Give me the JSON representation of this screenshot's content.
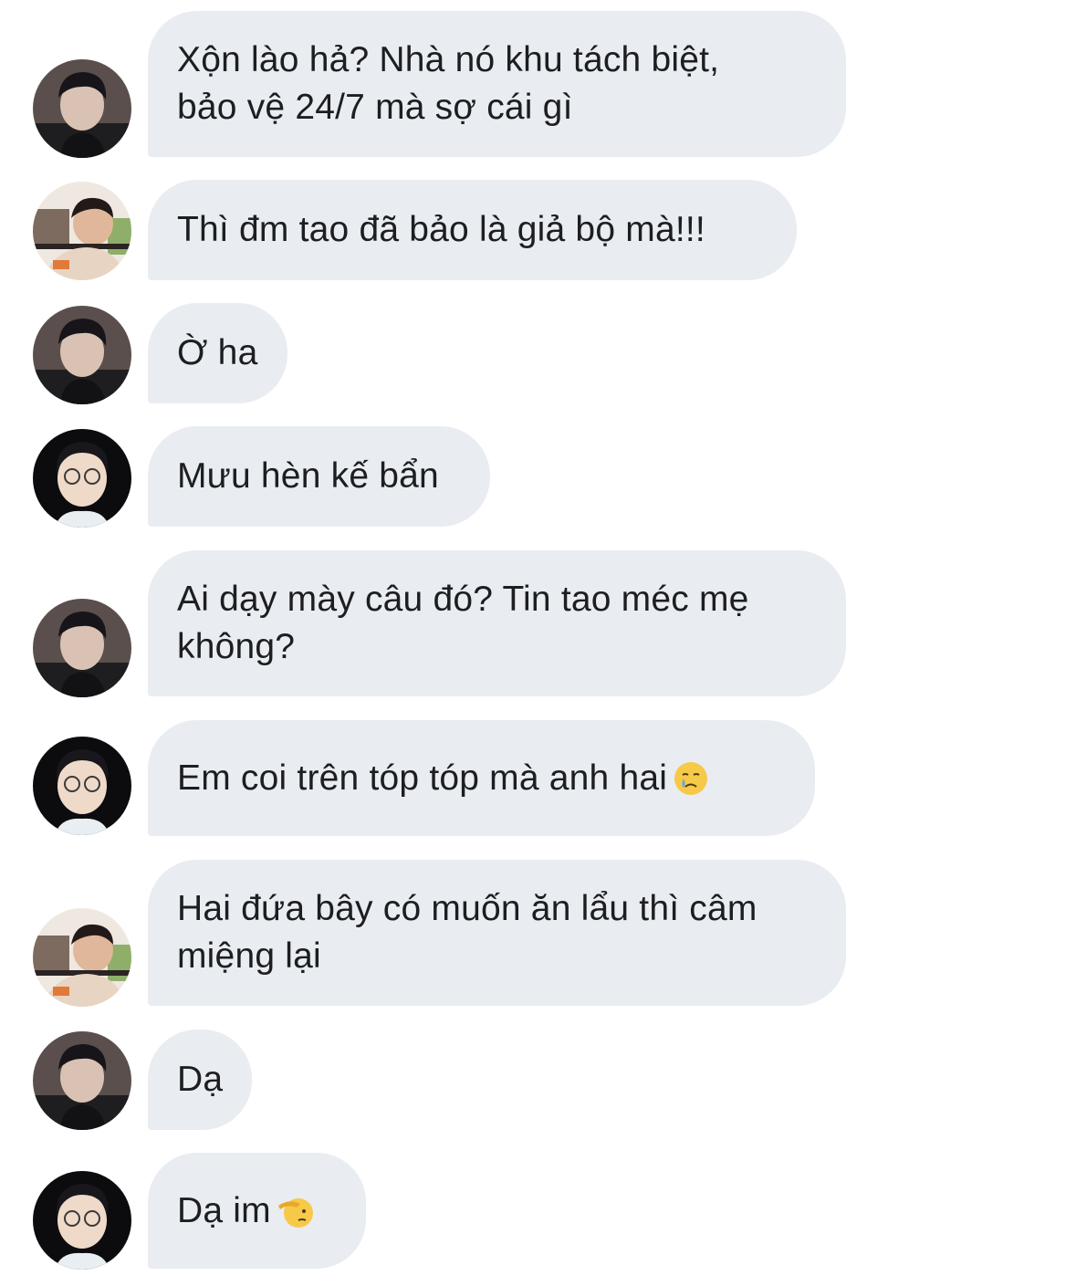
{
  "messages": [
    {
      "sender": "a",
      "text": "Xộn lào hả? Nhà nó khu tách biệt,\nbảo vệ 24/7 mà sợ cái gì"
    },
    {
      "sender": "b",
      "text": "Thì đm tao đã bảo là giả bộ mà!!!"
    },
    {
      "sender": "a",
      "text": "Ờ ha"
    },
    {
      "sender": "c",
      "text": "Mưu hèn kế bẩn"
    },
    {
      "sender": "a",
      "text": "Ai dạy mày câu đó? Tin tao méc mẹ\nkhông?"
    },
    {
      "sender": "c",
      "text": "Em coi trên tóp tóp mà anh hai",
      "emoji": "crying-face-emoji"
    },
    {
      "sender": "b",
      "text": "Hai đứa bây có muốn ăn lẩu thì câm\nmiệng lại"
    },
    {
      "sender": "a",
      "text": "Dạ"
    },
    {
      "sender": "c",
      "text": "Dạ im",
      "emoji": "saluting-face-emoji"
    }
  ],
  "colors": {
    "bubble": "#e9ecf1",
    "text": "#1c1e21",
    "background": "#ffffff"
  }
}
